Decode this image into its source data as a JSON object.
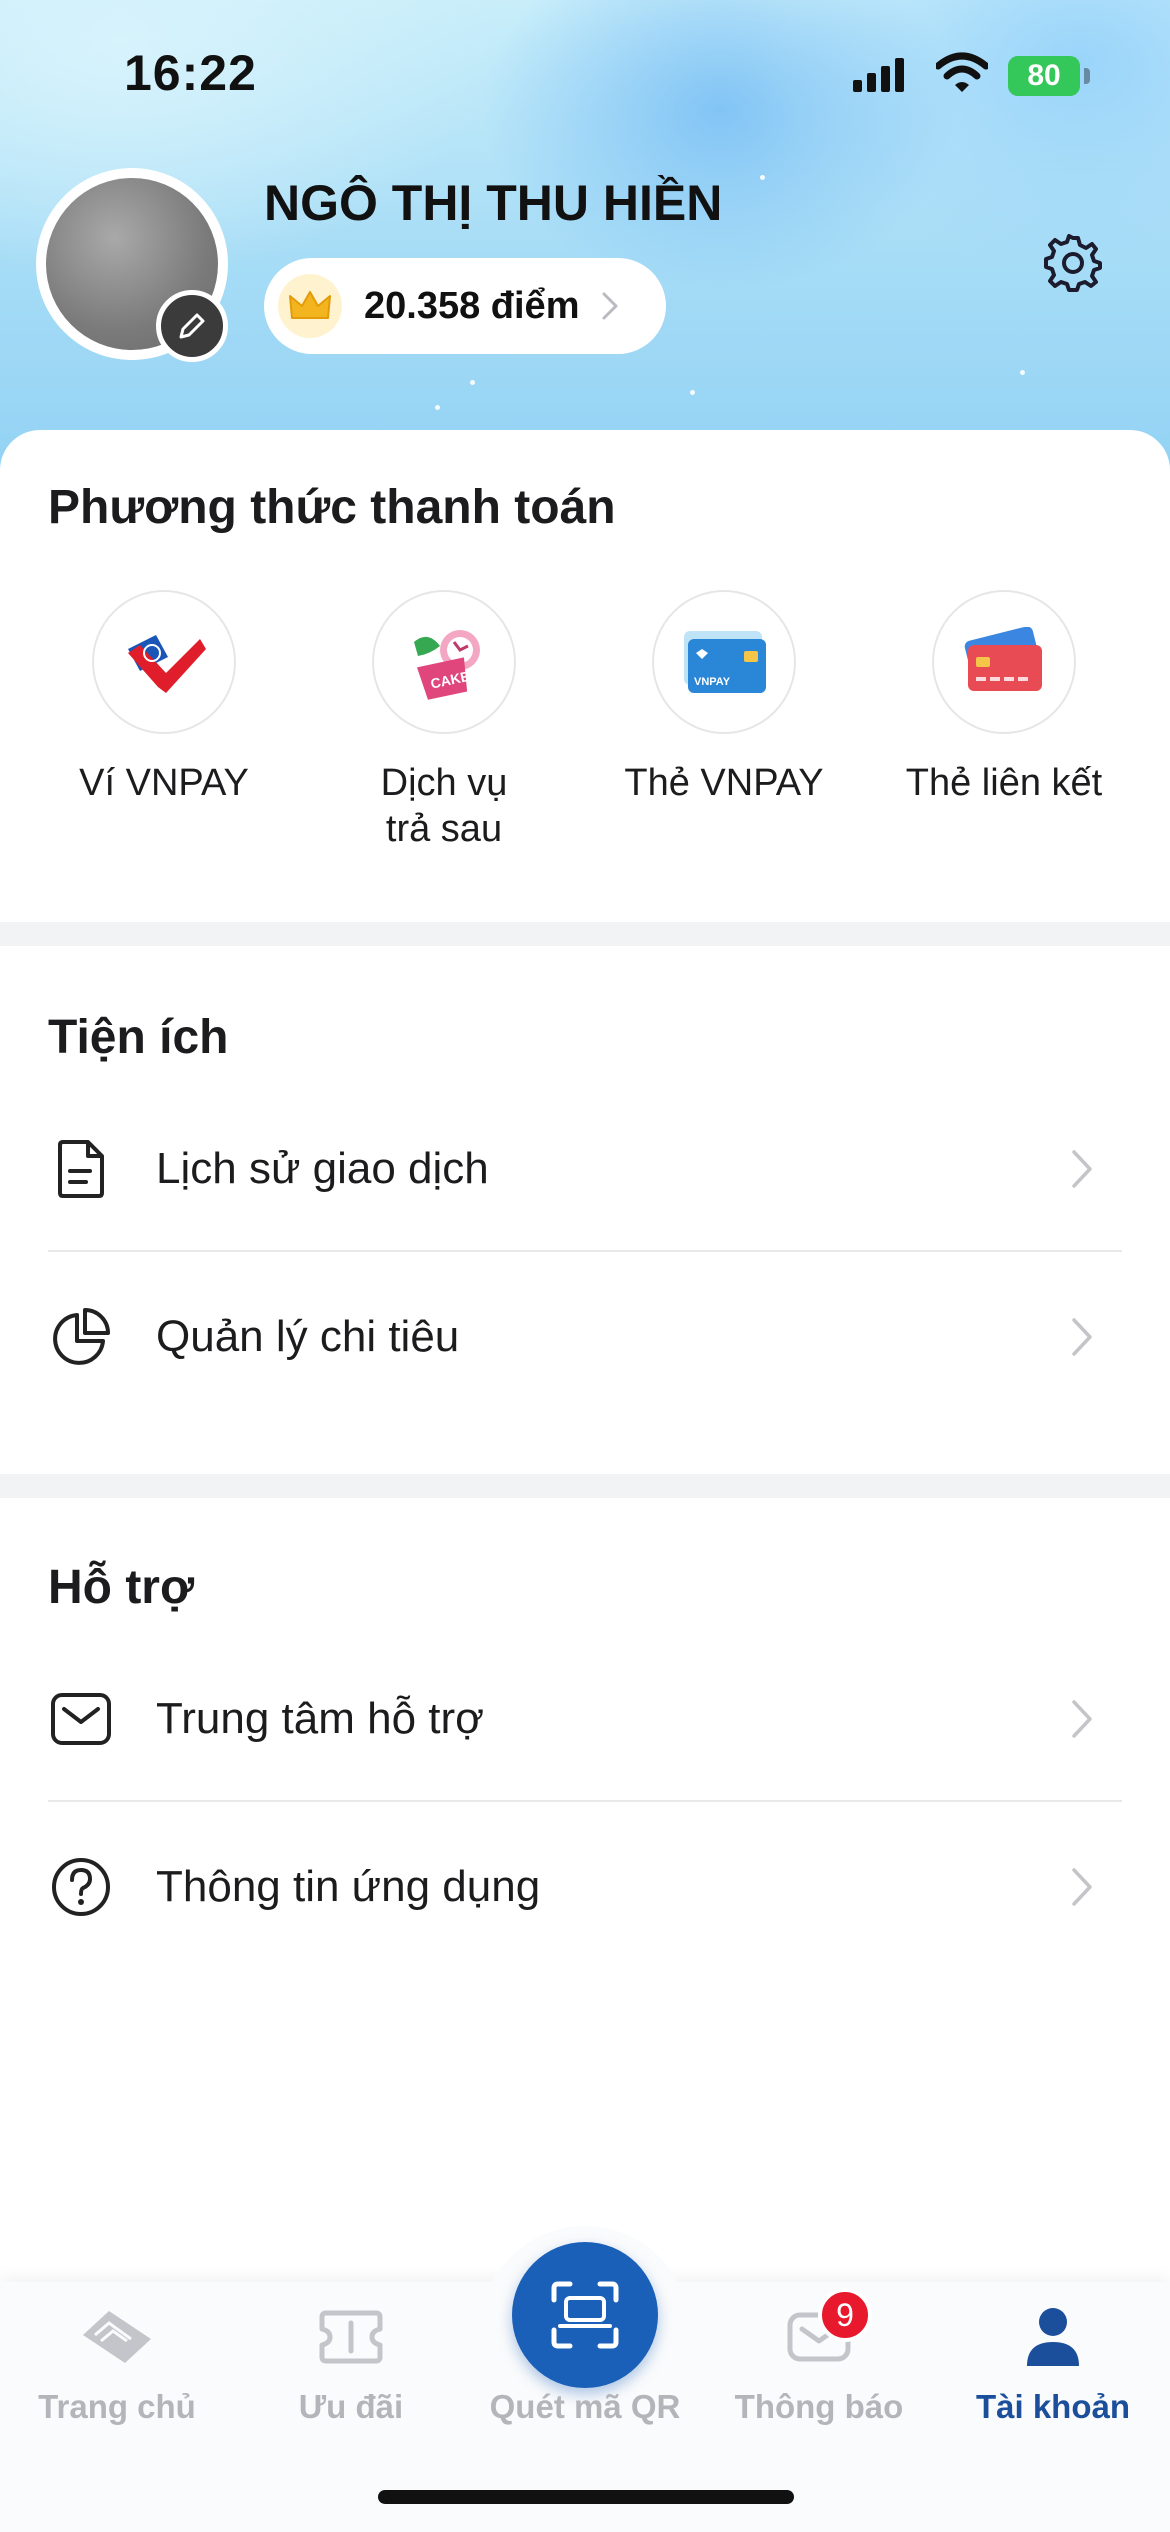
{
  "status_bar": {
    "time": "16:22",
    "battery": "80"
  },
  "profile": {
    "name": "NGÔ THỊ THU HIỀN",
    "points": "20.358 điểm"
  },
  "payment": {
    "title": "Phương thức thanh toán",
    "items": [
      {
        "label": "Ví VNPAY",
        "icon": "vnpay-wallet-icon"
      },
      {
        "label": "Dịch vụ trả sau",
        "label_line1": "Dịch vụ",
        "label_line2": "trả sau",
        "icon": "postpaid-cake-icon"
      },
      {
        "label": "Thẻ VNPAY",
        "icon": "vnpay-card-icon",
        "card_text": "VNPAY"
      },
      {
        "label": "Thẻ liên kết",
        "icon": "linked-card-icon"
      }
    ]
  },
  "utilities": {
    "title": "Tiện ích",
    "items": [
      {
        "label": "Lịch sử giao dịch",
        "icon": "document-icon"
      },
      {
        "label": "Quản lý chi tiêu",
        "icon": "pie-chart-icon"
      }
    ]
  },
  "support": {
    "title": "Hỗ trợ",
    "items": [
      {
        "label": "Trung tâm hỗ trợ",
        "icon": "mail-icon"
      },
      {
        "label": "Thông tin ứng dụng",
        "icon": "question-icon"
      }
    ]
  },
  "bottom_nav": {
    "items": [
      {
        "label": "Trang chủ",
        "icon": "home-icon",
        "active": false
      },
      {
        "label": "Ưu đãi",
        "icon": "ticket-icon",
        "active": false
      },
      {
        "label": "Quét mã QR",
        "icon": "qr-scan-icon",
        "active": false
      },
      {
        "label": "Thông báo",
        "icon": "notification-icon",
        "active": false,
        "badge": "9"
      },
      {
        "label": "Tài khoản",
        "icon": "account-icon",
        "active": true
      }
    ]
  },
  "colors": {
    "accent": "#1a5fb8",
    "active_nav": "#1b4f9c",
    "badge": "#e8192c",
    "battery": "#34c759"
  }
}
